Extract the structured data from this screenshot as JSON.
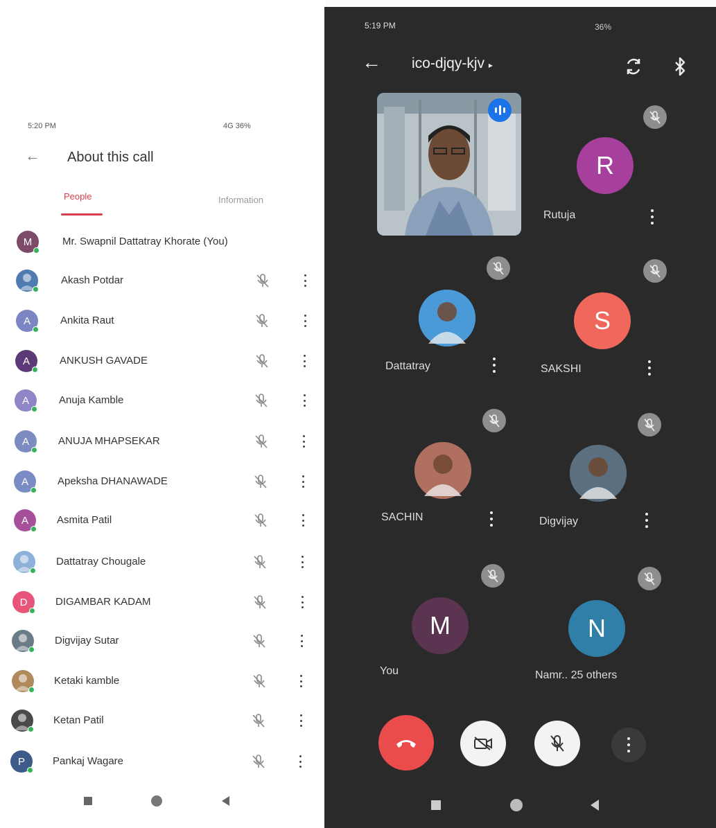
{
  "about_screen": {
    "status_time": "5:20 PM",
    "status_right": "4G 36%",
    "title": "About this call",
    "tabs": [
      {
        "label": "People",
        "active": true
      },
      {
        "label": "Information",
        "active": false
      }
    ],
    "participants": [
      {
        "initial": "M",
        "name": "Mr. Swapnil Dattatray Khorate (You)",
        "color": "#7e4a6a",
        "photo": false,
        "you": true
      },
      {
        "initial": "",
        "name": "Akash Potdar",
        "color": "#4f7bb0",
        "photo": true
      },
      {
        "initial": "A",
        "name": "Ankita Raut",
        "color": "#7b86c2"
      },
      {
        "initial": "A",
        "name": "ANKUSH GAVADE",
        "color": "#5d3a77"
      },
      {
        "initial": "A",
        "name": "Anuja Kamble",
        "color": "#8e86c6"
      },
      {
        "initial": "A",
        "name": "ANUJA MHAPSEKAR",
        "color": "#7c8bc0"
      },
      {
        "initial": "A",
        "name": "Apeksha DHANAWADE",
        "color": "#7b8bc3"
      },
      {
        "initial": "A",
        "name": "Asmita Patil",
        "color": "#a6509c"
      },
      {
        "initial": "",
        "name": "Dattatray Chougale",
        "color": "#8fb0d8",
        "photo": true
      },
      {
        "initial": "D",
        "name": "DIGAMBAR KADAM",
        "color": "#e8557a"
      },
      {
        "initial": "",
        "name": "Digvijay Sutar",
        "color": "#6b7c86",
        "photo": true
      },
      {
        "initial": "",
        "name": "Ketaki kamble",
        "color": "#b08a5a",
        "photo": true
      },
      {
        "initial": "",
        "name": "Ketan Patil",
        "color": "#4a4a4a",
        "photo": true
      },
      {
        "initial": "P",
        "name": "Pankaj Wagare",
        "color": "#3c5a8a"
      }
    ]
  },
  "call_screen": {
    "status_time": "5:19 PM",
    "status_right": "36%",
    "meeting_code": "ico-djqy-kjv",
    "tiles": [
      {
        "name": "Rutuja",
        "initial": "R",
        "color": "#a7409c",
        "photo": false
      },
      {
        "name": "Dattatray",
        "initial": "",
        "color": "#4a9ad8",
        "photo": true
      },
      {
        "name": "SAKSHI",
        "initial": "S",
        "color": "#f0685b",
        "photo": false
      },
      {
        "name": "SACHIN",
        "initial": "",
        "color": "#b07060",
        "photo": true
      },
      {
        "name": "Digvijay",
        "initial": "",
        "color": "#5a7080",
        "photo": true
      },
      {
        "name": "You",
        "initial": "M",
        "color": "#5a3450",
        "photo": false
      },
      {
        "name": "Namr.. 25 others",
        "initial": "N",
        "color": "#2f7fa8",
        "photo": false
      }
    ]
  },
  "icons": {
    "back": "arrow-left-icon",
    "mute": "mic-off-icon",
    "more": "more-vert-icon",
    "switch_camera": "switch-camera-icon",
    "bluetooth": "bluetooth-icon",
    "end_call": "end-call-icon",
    "camera_off": "camera-off-icon"
  }
}
